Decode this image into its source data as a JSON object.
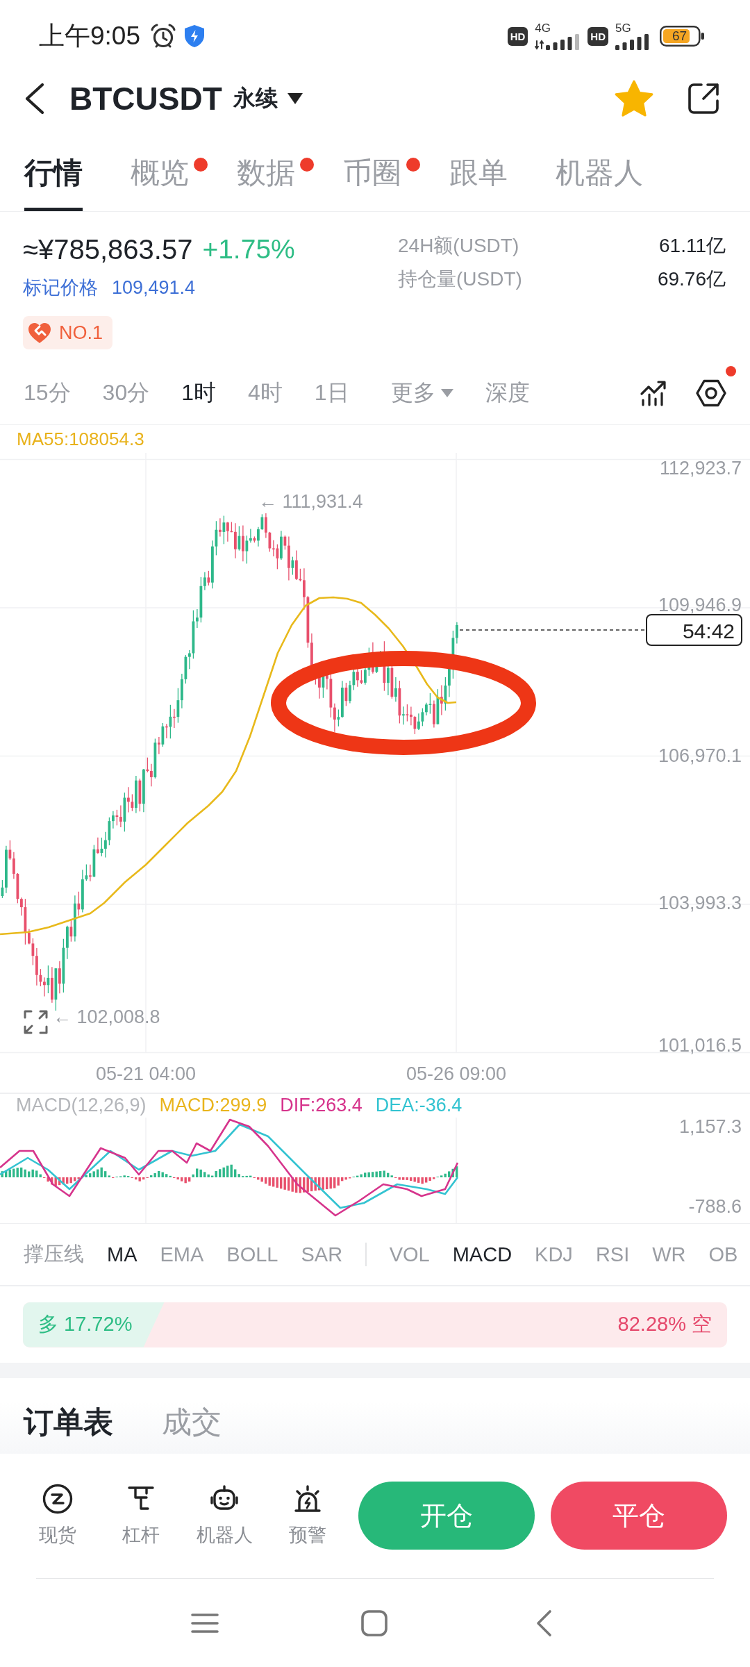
{
  "status_bar": {
    "time": "上午9:05",
    "networks": [
      {
        "badge": "HD",
        "type": "4G",
        "kind": "active"
      },
      {
        "badge": "HD",
        "type": "5G",
        "kind": "idle"
      }
    ],
    "battery": "67"
  },
  "header": {
    "symbol": "BTCUSDT",
    "contract": "永续",
    "favorite": true
  },
  "tabs": [
    {
      "label": "行情",
      "selected": true,
      "unread": false
    },
    {
      "label": "概览",
      "selected": false,
      "unread": true
    },
    {
      "label": "数据",
      "selected": false,
      "unread": true
    },
    {
      "label": "币圈",
      "selected": false,
      "unread": true
    },
    {
      "label": "跟单",
      "selected": false,
      "unread": false
    },
    {
      "label": "机器人",
      "selected": false,
      "unread": false
    }
  ],
  "ticker": {
    "price": "≈¥785,863.57",
    "change": "+1.75%",
    "mark_label": "标记价格",
    "mark_price": "109,491.4",
    "rank": "NO.1",
    "stats": [
      {
        "label": "24H额(USDT)",
        "value": "61.11亿"
      },
      {
        "label": "持仓量(USDT)",
        "value": "69.76亿"
      }
    ]
  },
  "timeframes": [
    {
      "label": "15分",
      "kind": "interval",
      "selected": false
    },
    {
      "label": "30分",
      "kind": "interval",
      "selected": false
    },
    {
      "label": "1时",
      "kind": "interval",
      "selected": true
    },
    {
      "label": "4时",
      "kind": "interval",
      "selected": false
    },
    {
      "label": "1日",
      "kind": "interval",
      "selected": false
    },
    {
      "label": "更多",
      "kind": "dropdown",
      "selected": false
    },
    {
      "label": "深度",
      "kind": "view",
      "selected": false
    }
  ],
  "chart_tools": {
    "settings_unread": true
  },
  "chart": {
    "ma_label": "MA55:108054.3",
    "price_labels": [
      "112,923.7",
      "109,946.9",
      "106,970.1",
      "103,993.3",
      "101,016.5"
    ],
    "high_label": "← 111,931.4",
    "low_label": "← 102,008.8",
    "countdown": "54:42",
    "time_labels": [
      "05-21 04:00",
      "05-26 09:00"
    ]
  },
  "macd": {
    "legend": [
      {
        "text": "MACD(12,26,9)",
        "color": "#b4b6ba"
      },
      {
        "text": "MACD:299.9",
        "color": "#e9b41c"
      },
      {
        "text": "DIF:263.4",
        "color": "#d6348c"
      },
      {
        "text": "DEA:-36.4",
        "color": "#33c3d1"
      }
    ],
    "axis_labels": [
      "1,157.3",
      "-788.6"
    ]
  },
  "indicators": {
    "main": [
      {
        "label": "撑压线",
        "selected": false
      },
      {
        "label": "MA",
        "selected": true
      },
      {
        "label": "EMA",
        "selected": false
      },
      {
        "label": "BOLL",
        "selected": false
      },
      {
        "label": "SAR",
        "selected": false
      }
    ],
    "sub": [
      {
        "label": "VOL",
        "selected": false
      },
      {
        "label": "MACD",
        "selected": true
      },
      {
        "label": "KDJ",
        "selected": false
      },
      {
        "label": "RSI",
        "selected": false
      },
      {
        "label": "WR",
        "selected": false
      },
      {
        "label": "OB",
        "selected": false
      }
    ]
  },
  "long_short": {
    "long": "多 17.72%",
    "short": "82.28% 空",
    "level": 0.1772
  },
  "order_tabs": [
    {
      "label": "订单表",
      "selected": true
    },
    {
      "label": "成交",
      "selected": false
    }
  ],
  "tools": [
    {
      "label": "现货",
      "kind": "spot"
    },
    {
      "label": "杠杆",
      "kind": "margin"
    },
    {
      "label": "机器人",
      "kind": "bot"
    },
    {
      "label": "预警",
      "kind": "alert"
    }
  ],
  "actions": [
    {
      "label": "开仓",
      "kind": "open"
    },
    {
      "label": "平仓",
      "kind": "close"
    }
  ]
}
